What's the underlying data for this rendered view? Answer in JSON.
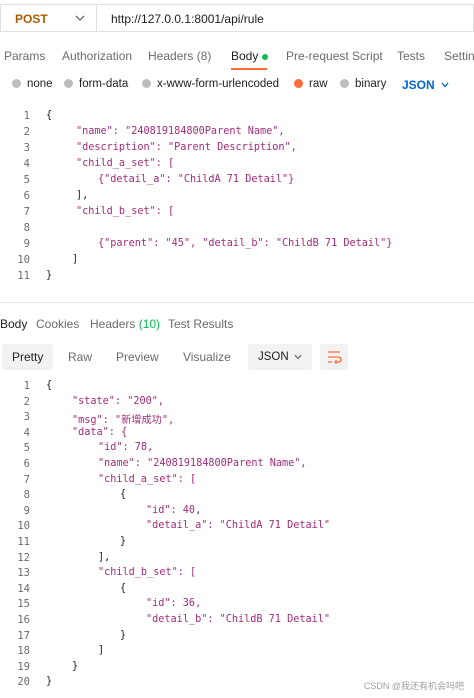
{
  "request": {
    "method": "POST",
    "url": "http://127.0.0.1:8001/api/rule"
  },
  "request_tabs": [
    {
      "label": "Params"
    },
    {
      "label": "Authorization"
    },
    {
      "label": "Headers (8)"
    },
    {
      "label": "Body"
    },
    {
      "label": "Pre-request Script"
    },
    {
      "label": "Tests"
    },
    {
      "label": "Settin"
    }
  ],
  "body_types": [
    {
      "label": "none"
    },
    {
      "label": "form-data"
    },
    {
      "label": "x-www-form-urlencoded"
    },
    {
      "label": "raw"
    },
    {
      "label": "binary"
    }
  ],
  "body_format": "JSON",
  "request_body": {
    "line_numbers": [
      "1",
      "2",
      "3",
      "4",
      "5",
      "6",
      "7",
      "8",
      "9",
      "10",
      "11"
    ],
    "lines": [
      "{",
      "\"name\": \"240819184800Parent Name\",",
      "\"description\": \"Parent Description\",",
      "\"child_a_set\": [",
      "{\"detail_a\": \"ChildA 71 Detail\"}",
      "],",
      "\"child_b_set\": [",
      "",
      "{\"parent\": \"45\", \"detail_b\": \"ChildB 71 Detail\"}",
      "]",
      "}"
    ]
  },
  "response_tabs": [
    {
      "label": "Body"
    },
    {
      "label": "Cookies"
    },
    {
      "label": "Headers",
      "count": "(10)"
    },
    {
      "label": "Test Results"
    }
  ],
  "view_modes": [
    {
      "label": "Pretty"
    },
    {
      "label": "Raw"
    },
    {
      "label": "Preview"
    },
    {
      "label": "Visualize"
    }
  ],
  "response_format": "JSON",
  "response_body": {
    "line_numbers": [
      "1",
      "2",
      "3",
      "4",
      "5",
      "6",
      "7",
      "8",
      "9",
      "10",
      "11",
      "12",
      "13",
      "14",
      "15",
      "16",
      "17",
      "18",
      "19",
      "20"
    ],
    "lines": [
      "{",
      "\"state\": \"200\",",
      "\"msg\": \"新增成功\",",
      "\"data\": {",
      "\"id\": 78,",
      "\"name\": \"240819184800Parent Name\",",
      "\"child_a_set\": [",
      "{",
      "\"id\": 40,",
      "\"detail_a\": \"ChildA 71 Detail\"",
      "}",
      "],",
      "\"child_b_set\": [",
      "{",
      "\"id\": 36,",
      "\"detail_b\": \"ChildB 71 Detail\"",
      "}",
      "]",
      "}",
      "}"
    ]
  },
  "watermark": "CSDN @我还有机会吗吧"
}
